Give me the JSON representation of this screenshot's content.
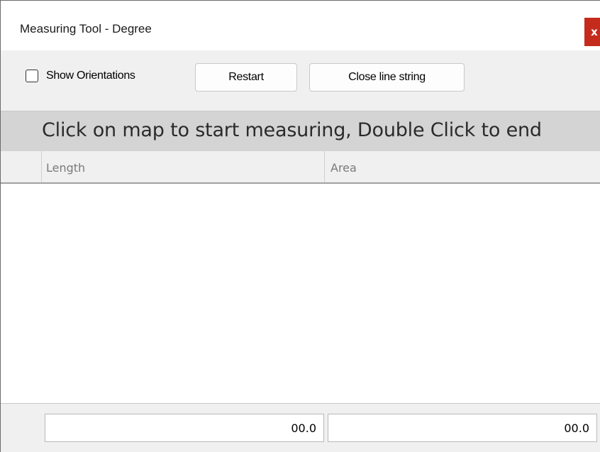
{
  "window": {
    "title": "Measuring Tool - Degree",
    "close_glyph": "x"
  },
  "toolbar": {
    "show_orientations_label": "Show Orientations",
    "show_orientations_checked": false,
    "restart_label": "Restart",
    "close_line_string_label": "Close line string"
  },
  "hint": {
    "text": "Click on map to start measuring, Double Click to end"
  },
  "table": {
    "columns": [
      "Length",
      "Area"
    ],
    "rows": []
  },
  "totals": {
    "length": "00.0",
    "area": "00.0"
  },
  "colors": {
    "close_button": "#c42b1c",
    "hint_bar": "#d4d4d4",
    "window_bg": "#f0f0f0"
  },
  "icons": {
    "close": "close-icon",
    "checkbox": "checkbox-unchecked-icon"
  }
}
